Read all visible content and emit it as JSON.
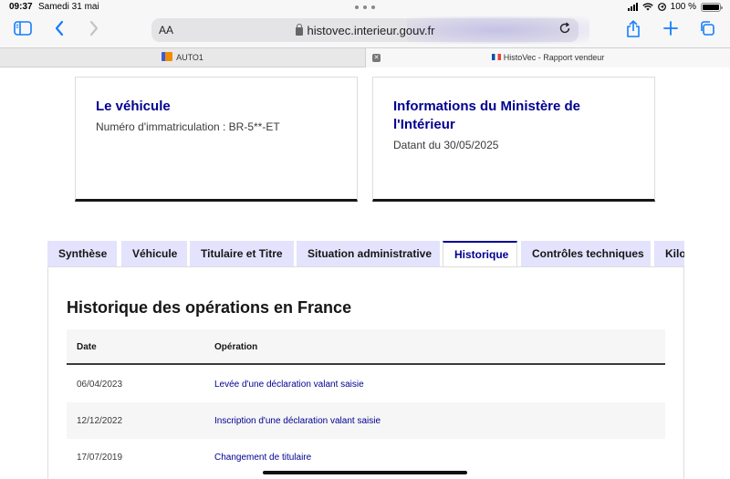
{
  "status_bar": {
    "time": "09:37",
    "date": "Samedi 31 mai",
    "battery": "100 %"
  },
  "toolbar": {
    "text_size_label": "AA",
    "url": "histovec.interieur.gouv.fr"
  },
  "tabs": [
    {
      "title": "AUTO1"
    },
    {
      "title": "HistoVec - Rapport vendeur"
    }
  ],
  "cards": {
    "vehicle": {
      "title": "Le véhicule",
      "text": "Numéro d'immatriculation : BR-5**-ET"
    },
    "ministry": {
      "title": "Informations du Ministère de l'Intérieur",
      "text": "Datant du 30/05/2025"
    }
  },
  "nav_tabs": [
    {
      "label": "Synthèse"
    },
    {
      "label": "Véhicule"
    },
    {
      "label": "Titulaire et Titre"
    },
    {
      "label": "Situation administrative"
    },
    {
      "label": "Historique",
      "active": true
    },
    {
      "label": "Contrôles techniques"
    },
    {
      "label": "Kilo"
    }
  ],
  "history": {
    "title": "Historique des opérations en France",
    "columns": {
      "date": "Date",
      "operation": "Opération"
    },
    "rows": [
      {
        "date": "06/04/2023",
        "operation": "Levée d'une déclaration valant saisie"
      },
      {
        "date": "12/12/2022",
        "operation": "Inscription d'une déclaration valant saisie"
      },
      {
        "date": "17/07/2019",
        "operation": "Changement de titulaire"
      }
    ]
  },
  "colors": {
    "accent": "#000091",
    "tab_bg": "#e3e3fd",
    "safari_blue": "#147efb"
  }
}
